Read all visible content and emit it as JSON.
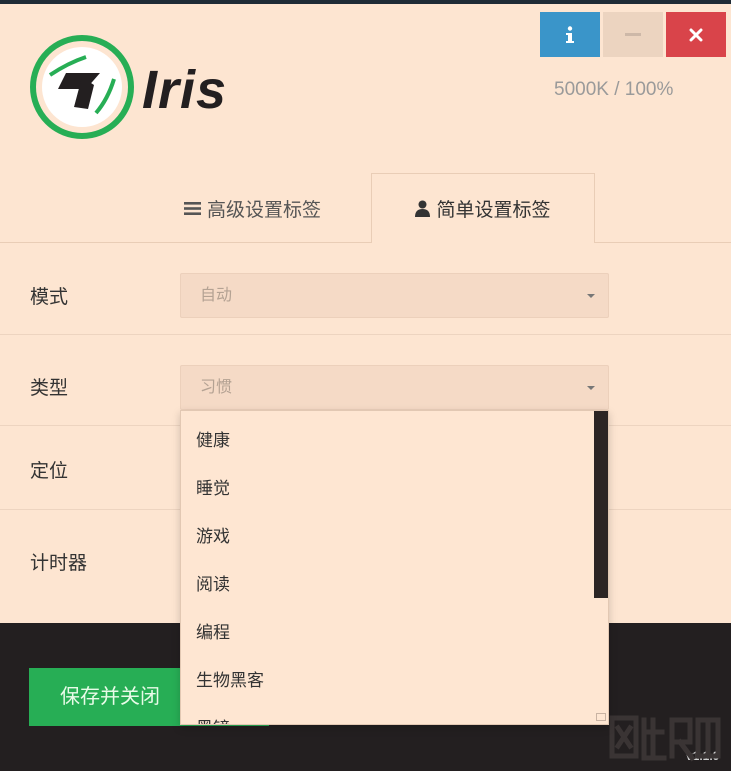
{
  "window": {
    "info_label": "i",
    "minimize_label": "—",
    "close_label": "✕",
    "status": "5000K / 100%"
  },
  "brand": {
    "name": "Iris"
  },
  "tabs": [
    {
      "label": "高级设置标签",
      "icon": "menu-icon",
      "active": false
    },
    {
      "label": "简单设置标签",
      "icon": "user-icon",
      "active": true
    }
  ],
  "form": {
    "mode": {
      "label": "模式",
      "value": "自动"
    },
    "type": {
      "label": "类型",
      "value": "习惯"
    },
    "location": {
      "label": "定位"
    },
    "timer": {
      "label": "计时器"
    }
  },
  "dropdown": {
    "options": [
      "健康",
      "睡觉",
      "游戏",
      "阅读",
      "编程",
      "生物黑客",
      "黑镜"
    ]
  },
  "footer": {
    "save_label": "保存并关闭",
    "version": "v1.1.9"
  },
  "colors": {
    "background": "#fde5d1",
    "info": "#3a95c9",
    "close": "#d9444a",
    "save": "#27ae55",
    "dark": "#231f20",
    "logo_ring": "#27ae55"
  }
}
